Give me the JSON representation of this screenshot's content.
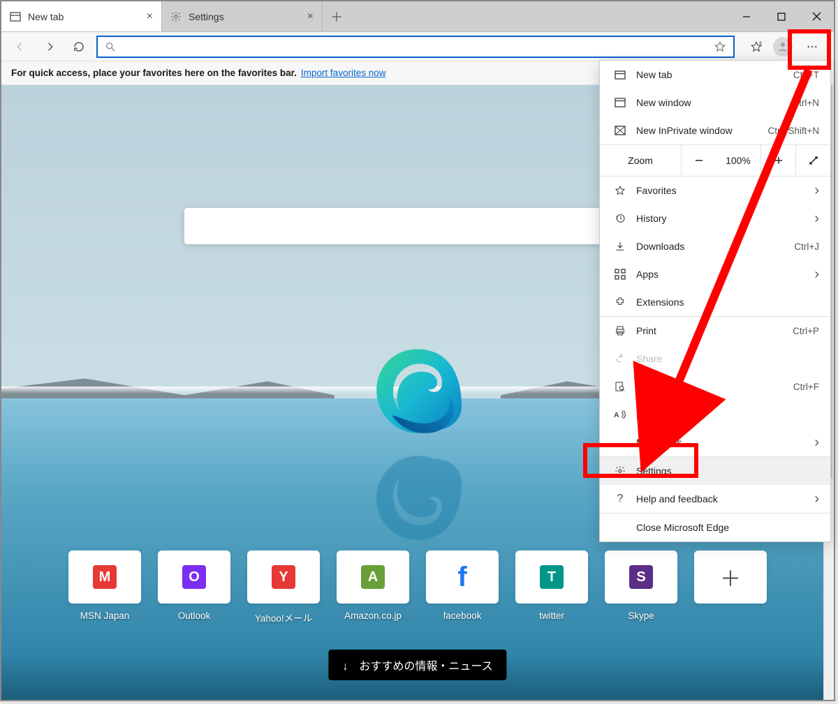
{
  "tabs": [
    {
      "label": "New tab"
    },
    {
      "label": "Settings"
    }
  ],
  "favorites_prompt": {
    "text": "For quick access, place your favorites here on the favorites bar.",
    "link": "Import favorites now"
  },
  "omnibox_value": "",
  "tiles": [
    {
      "letter": "M",
      "colorClass": "b-red",
      "label": "MSN Japan"
    },
    {
      "letter": "O",
      "colorClass": "b-purple",
      "label": "Outlook"
    },
    {
      "letter": "Y",
      "colorClass": "b-y",
      "label": "Yahoo!メール"
    },
    {
      "letter": "A",
      "colorClass": "b-green",
      "label": "Amazon.co.jp"
    },
    {
      "letter": "f",
      "colorClass": "b-fb",
      "label": "facebook"
    },
    {
      "letter": "T",
      "colorClass": "b-teal",
      "label": "twitter"
    },
    {
      "letter": "S",
      "colorClass": "b-skype",
      "label": "Skype"
    }
  ],
  "add_tile_label": "",
  "news_button": "↓　おすすめの情報・ニュース",
  "menu": {
    "new_tab": {
      "label": "New tab",
      "shortcut": "Ctrl+T"
    },
    "new_window": {
      "label": "New window",
      "shortcut": "Ctrl+N"
    },
    "inprivate": {
      "label": "New InPrivate window",
      "shortcut": "Ctrl+Shift+N"
    },
    "zoom_label": "Zoom",
    "zoom_value": "100%",
    "favorites": {
      "label": "Favorites"
    },
    "history": {
      "label": "History"
    },
    "downloads": {
      "label": "Downloads",
      "shortcut": "Ctrl+J"
    },
    "apps": {
      "label": "Apps"
    },
    "extensions": {
      "label": "Extensions"
    },
    "print": {
      "label": "Print",
      "shortcut": "Ctrl+P"
    },
    "share": {
      "label": "Share"
    },
    "find": {
      "label": "Find on page",
      "shortcut": "Ctrl+F"
    },
    "read": {
      "label": "Read aloud"
    },
    "more_tools": {
      "label": "More tools"
    },
    "settings": {
      "label": "Settings"
    },
    "help": {
      "label": "Help and feedback"
    },
    "close": {
      "label": "Close Microsoft Edge"
    }
  }
}
